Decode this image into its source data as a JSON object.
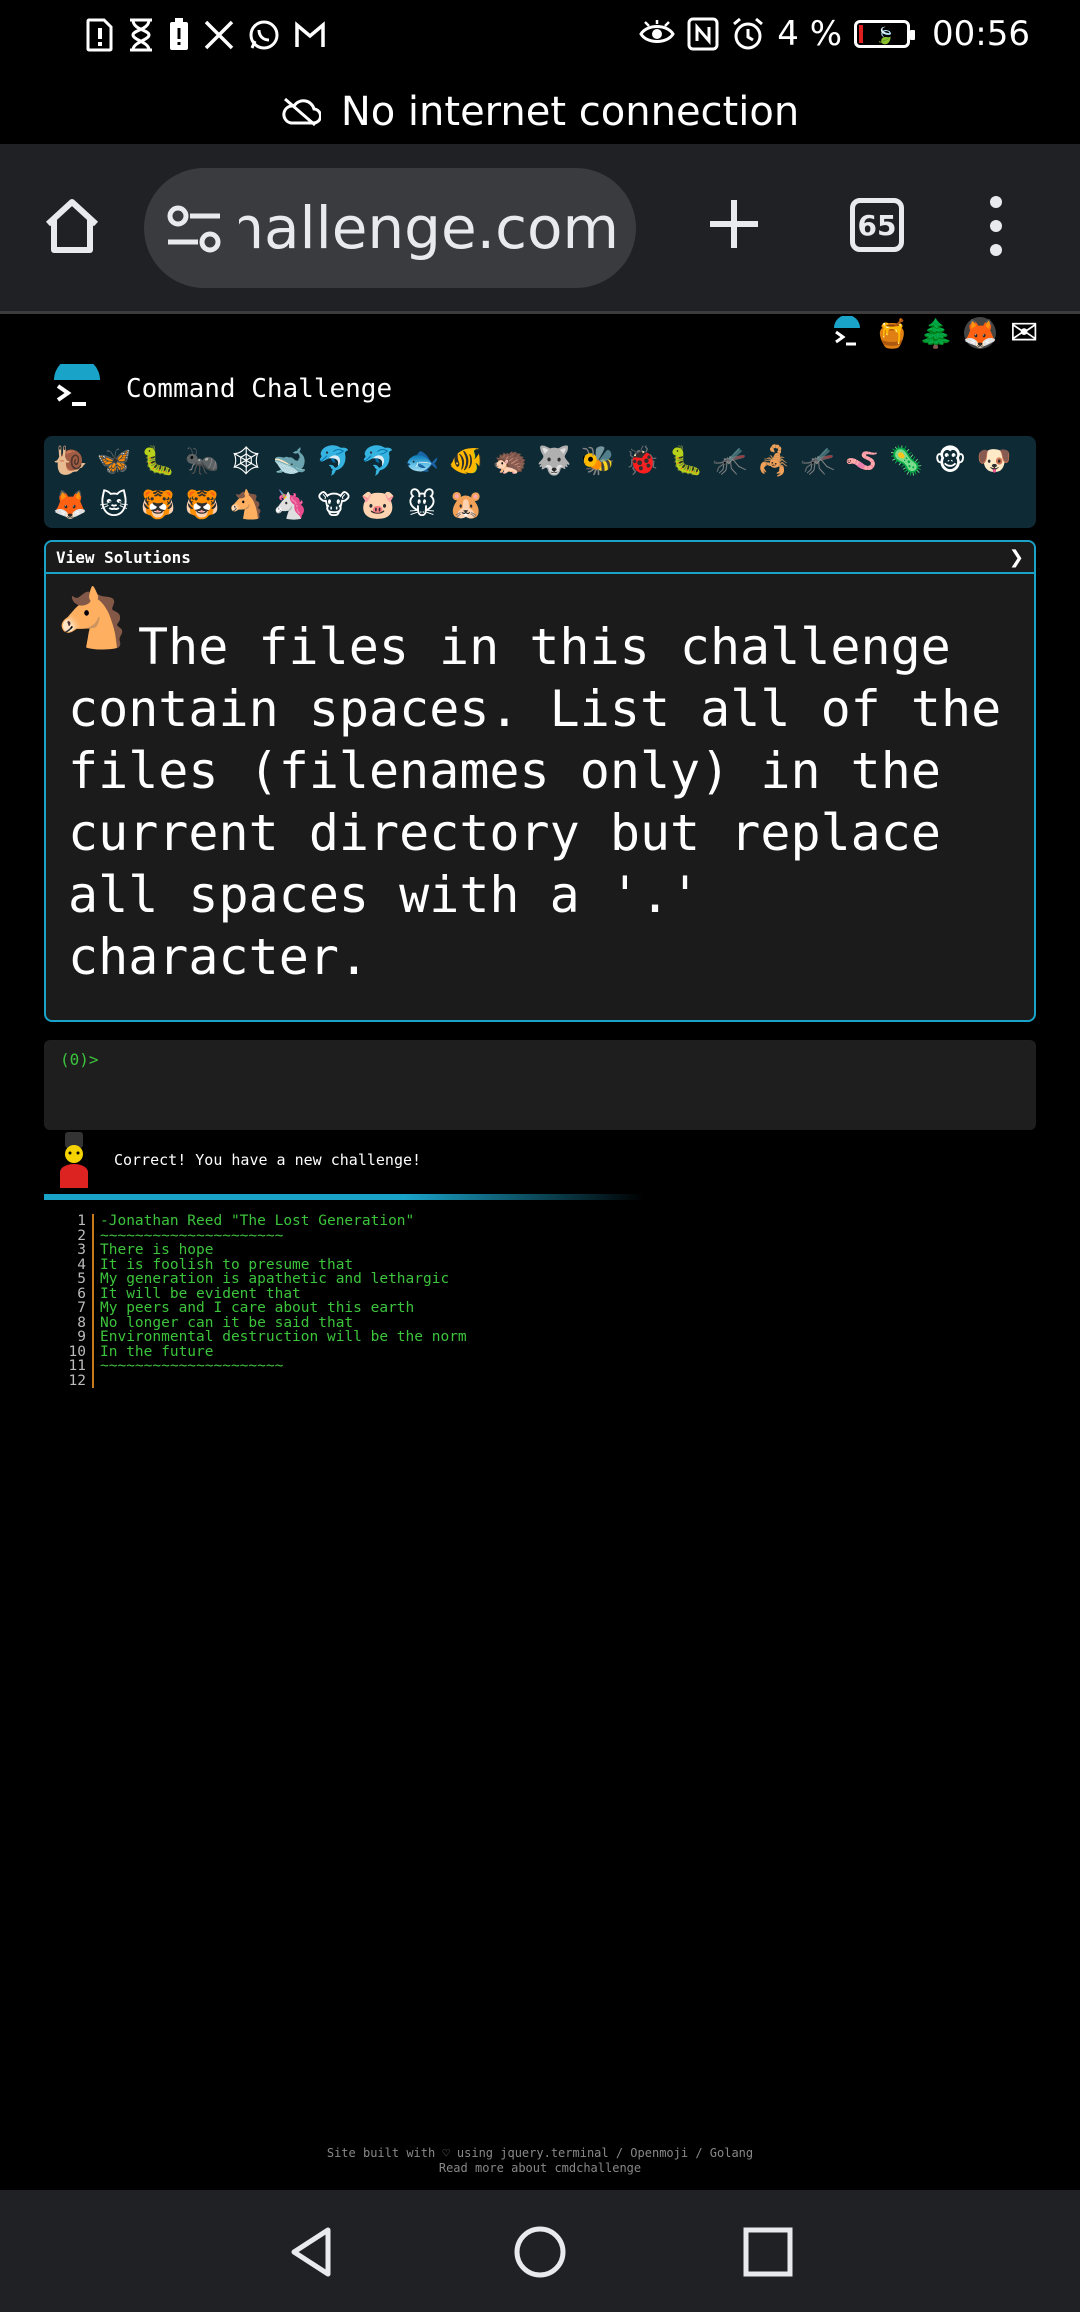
{
  "status_bar": {
    "battery_percent": "4 %",
    "time": "00:56",
    "left_icons": [
      "alert-file-icon",
      "hourglass-icon",
      "battery-alert-icon",
      "x-icon",
      "whatsapp-icon",
      "gmail-icon"
    ],
    "right_icons": [
      "eye-icon",
      "nfc-icon",
      "alarm-icon",
      "battery-icon"
    ]
  },
  "banner": {
    "text": "No internet connection"
  },
  "browser": {
    "url_display": "cmdchallenge.com",
    "tab_count": "65"
  },
  "site": {
    "title": "Command Challenge",
    "top_icons": [
      "🍯",
      "🌲",
      "🦊",
      "✉"
    ],
    "emojis": [
      "🐌",
      "🦋",
      "🐛",
      "🐜",
      "🕸",
      "🐋",
      "🐬",
      "🐬",
      "🐟",
      "🐠",
      "🦔",
      "🐺",
      "🐝",
      "🐞",
      "🐛",
      "🦟",
      "🦂",
      "🦟",
      "🪱",
      "🦠",
      "🐵",
      "🐶",
      "🦊",
      "🐱",
      "🐯",
      "🐯",
      "🐴",
      "🦄",
      "🐮",
      "🐷",
      "🐭",
      "🐹"
    ]
  },
  "challenge": {
    "header": "View Solutions",
    "arrow": "❯",
    "emoji": "🐴",
    "text": "The files in this challenge contain spaces. List all of the files (filenames only) in the current directory but replace all spaces with a '.' character."
  },
  "terminal": {
    "prompt": "(0)>"
  },
  "result": {
    "text": "Correct! You have a new challenge!",
    "progress": 0.58
  },
  "poem": [
    {
      "n": "1",
      "t": "-Jonathan Reed \"The Lost Generation\""
    },
    {
      "n": "2",
      "t": "~~~~~~~~~~~~~~~~~~~~~"
    },
    {
      "n": "3",
      "t": "There is hope"
    },
    {
      "n": "4",
      "t": "It is foolish to presume that"
    },
    {
      "n": "5",
      "t": "My generation is apathetic and lethargic"
    },
    {
      "n": "6",
      "t": "It will be evident that"
    },
    {
      "n": "7",
      "t": "My peers and I care about this earth"
    },
    {
      "n": "8",
      "t": "No longer can it be said that"
    },
    {
      "n": "9",
      "t": "Environmental destruction will be the norm"
    },
    {
      "n": "10",
      "t": "In the future"
    },
    {
      "n": "11",
      "t": "~~~~~~~~~~~~~~~~~~~~~"
    },
    {
      "n": "12",
      "t": ""
    }
  ],
  "footer": {
    "line1": "Site built with ♡ using jquery.terminal / Openmoji / Golang",
    "line2": "Read more about cmdchallenge"
  }
}
